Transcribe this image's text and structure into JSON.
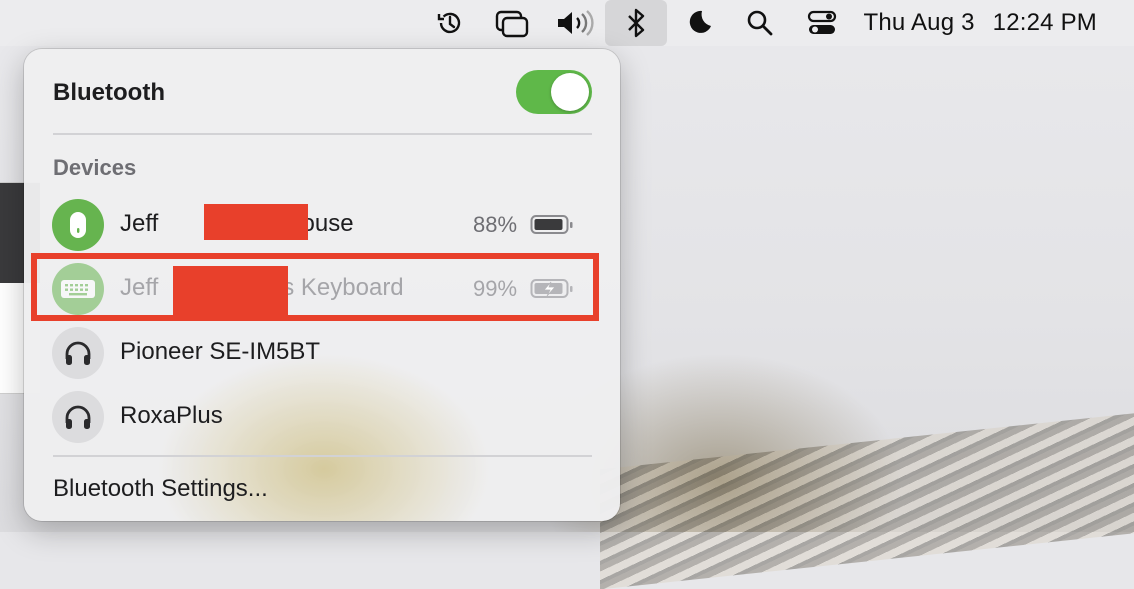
{
  "menubar": {
    "icons": [
      "time-machine-icon",
      "window-stack-icon",
      "volume-icon",
      "bluetooth-icon",
      "focus-moon-icon",
      "search-icon",
      "control-center-icon"
    ],
    "date": "Thu Aug 3",
    "time": "12:24 PM"
  },
  "panel": {
    "title": "Bluetooth",
    "toggle_on": true,
    "section_title": "Devices",
    "devices": [
      {
        "name_prefix": "Jeff",
        "name_suffix": "'s Mouse",
        "battery": "88%",
        "icon": "mouse-icon",
        "connected": true
      },
      {
        "name_prefix": "Jeff",
        "name_suffix": "s Keyboard",
        "battery": "99%",
        "icon": "keyboard-icon",
        "connected": false,
        "charging": true
      },
      {
        "name": "Pioneer SE-IM5BT",
        "icon": "headphones-icon"
      },
      {
        "name": "RoxaPlus",
        "icon": "headphones-icon"
      }
    ],
    "settings_label": "Bluetooth Settings..."
  },
  "colors": {
    "toggle": "#5fb849",
    "connected_circle": "#66b44f",
    "redaction": "#e8402b",
    "highlight_border": "#e8402b"
  }
}
